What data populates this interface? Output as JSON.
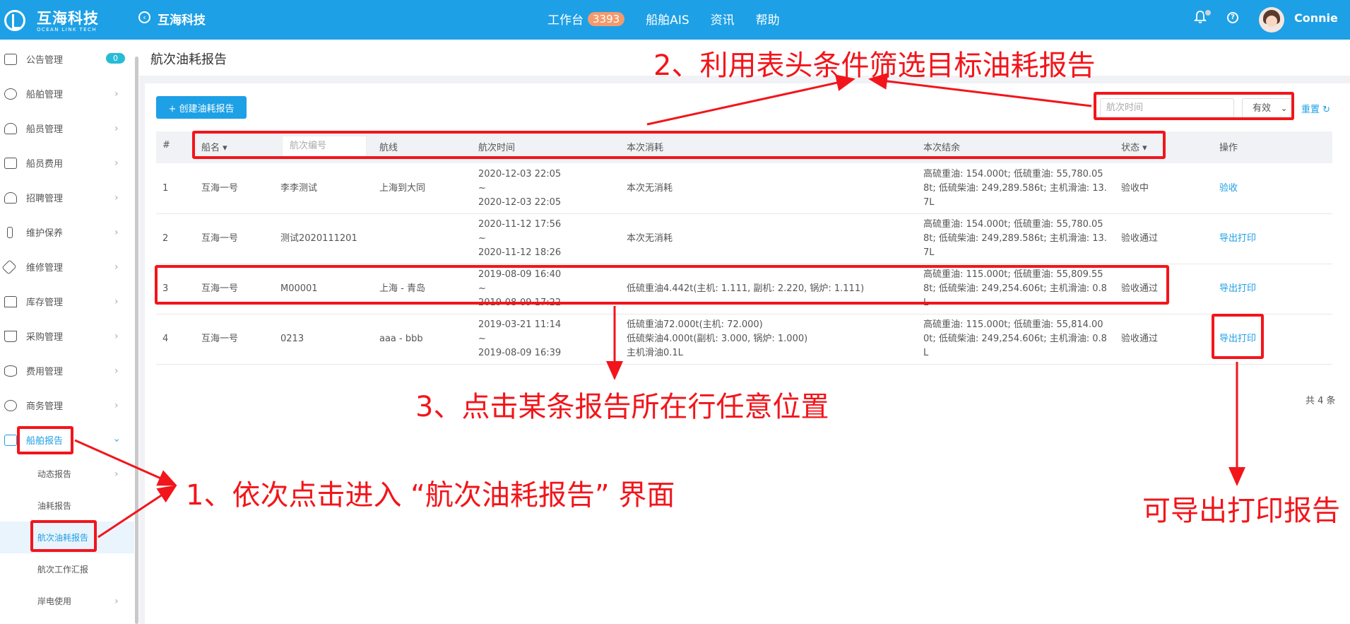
{
  "topbar": {
    "logo_cn": "互海科技",
    "logo_en": "OCEAN LINK TECH",
    "company": "互海科技",
    "nav": [
      {
        "label": "工作台",
        "badge": "3393"
      },
      {
        "label": "船舶AIS"
      },
      {
        "label": "资讯"
      },
      {
        "label": "帮助"
      }
    ],
    "username": "Connie"
  },
  "sidebar": {
    "items": [
      {
        "label": "公告管理",
        "badge": "0"
      },
      {
        "label": "船舶管理"
      },
      {
        "label": "船员管理"
      },
      {
        "label": "船员费用"
      },
      {
        "label": "招聘管理"
      },
      {
        "label": "维护保养"
      },
      {
        "label": "维修管理"
      },
      {
        "label": "库存管理"
      },
      {
        "label": "采购管理"
      },
      {
        "label": "费用管理"
      },
      {
        "label": "商务管理"
      },
      {
        "label": "船舶报告"
      }
    ],
    "sub_items": [
      {
        "label": "动态报告"
      },
      {
        "label": "油耗报告"
      },
      {
        "label": "航次油耗报告"
      },
      {
        "label": "航次工作汇报"
      },
      {
        "label": "岸电使用"
      }
    ]
  },
  "page": {
    "title": "航次油耗报告",
    "create_button": "+ 创建油耗报告",
    "filter_placeholder": "航次时间",
    "status_filter": "有效",
    "reset": "重置",
    "total": "共 4 条"
  },
  "table": {
    "headers": {
      "index": "#",
      "ship": "船名",
      "voyage_no_placeholder": "航次编号",
      "route": "航线",
      "voyage_time": "航次时间",
      "consumption": "本次消耗",
      "remaining": "本次结余",
      "status": "状态",
      "action": "操作"
    },
    "rows": [
      {
        "index": "1",
        "ship": "互海一号",
        "voyage_no": "李李测试",
        "route": "上海到大同",
        "time": [
          "2020-12-03 22:05",
          "~",
          "2020-12-03 22:05"
        ],
        "consumption": [
          "本次无消耗"
        ],
        "remaining": [
          "高硫重油: 154.000t; 低硫重油: 55,780.05",
          "8t; 低硫柴油: 249,289.586t; 主机滑油: 13.",
          "7L"
        ],
        "status": "验收中",
        "action": "验收"
      },
      {
        "index": "2",
        "ship": "互海一号",
        "voyage_no": "测试2020111201",
        "route": "",
        "time": [
          "2020-11-12 17:56",
          "~",
          "2020-11-12 18:26"
        ],
        "consumption": [
          "本次无消耗"
        ],
        "remaining": [
          "高硫重油: 154.000t; 低硫重油: 55,780.05",
          "8t; 低硫柴油: 249,289.586t; 主机滑油: 13.",
          "7L"
        ],
        "status": "验收通过",
        "action": "导出打印"
      },
      {
        "index": "3",
        "ship": "互海一号",
        "voyage_no": "M00001",
        "route": "上海 - 青岛",
        "time": [
          "2019-08-09 16:40",
          "~",
          "2019-08-09 17:22"
        ],
        "consumption": [
          "低硫重油4.442t(主机: 1.111, 副机: 2.220, 锅炉: 1.111)"
        ],
        "remaining": [
          "高硫重油: 115.000t; 低硫重油: 55,809.55",
          "8t; 低硫柴油: 249,254.606t; 主机滑油: 0.8",
          "L"
        ],
        "status": "验收通过",
        "action": "导出打印"
      },
      {
        "index": "4",
        "ship": "互海一号",
        "voyage_no": "0213",
        "route": "aaa - bbb",
        "time": [
          "2019-03-21 11:14",
          "~",
          "2019-08-09 16:39"
        ],
        "consumption": [
          "低硫重油72.000t(主机: 72.000)",
          "低硫柴油4.000t(副机: 3.000, 锅炉: 1.000)",
          "主机滑油0.1L"
        ],
        "remaining": [
          "高硫重油: 115.000t; 低硫重油: 55,814.00",
          "0t; 低硫柴油: 249,254.606t; 主机滑油: 0.8",
          "L"
        ],
        "status": "验收通过",
        "action": "导出打印"
      }
    ]
  },
  "annotations": {
    "step1": "1、依次点击进入 “航次油耗报告” 界面",
    "step2": "2、利用表头条件筛选目标油耗报告",
    "step3": "3、点击某条报告所在行任意位置",
    "export_note": "可导出打印报告"
  },
  "colors": {
    "brand": "#1da0e6",
    "annotation": "#f2151b",
    "badge": "#f39a6e"
  }
}
